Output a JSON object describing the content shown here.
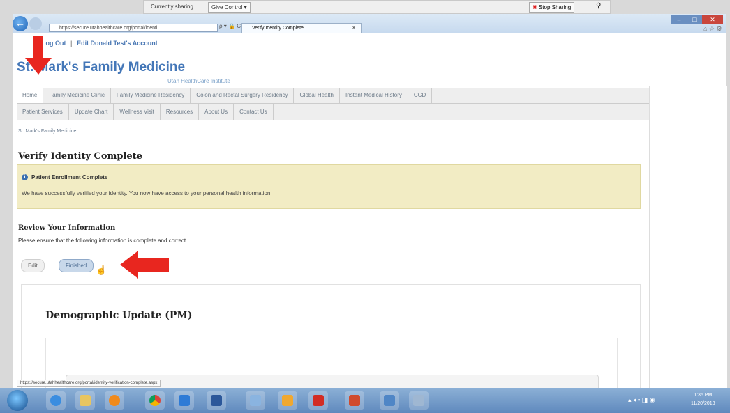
{
  "sharing_bar": {
    "currently_sharing": "Currently sharing",
    "give_control": "Give Control ▾",
    "stop_sharing": "Stop Sharing"
  },
  "browser": {
    "address": "https://secure.utahhealthcare.org/portal/identi",
    "tab_title": "Verify Identity Complete",
    "status_url": "https://secure.utahhealthcare.org/portal/identity-verification-complete.aspx"
  },
  "header": {
    "top_links_logout": "Log Out",
    "top_links_edit": "Edit Donald Test's Account",
    "site_title": "St. Mark's Family Medicine",
    "site_subtitle": "Utah HealthCare Institute"
  },
  "nav": {
    "row1": [
      "Home",
      "Family Medicine Clinic",
      "Family Medicine Residency",
      "Colon and Rectal Surgery Residency",
      "Global Health",
      "Instant Medical History",
      "CCD"
    ],
    "row2": [
      "Patient Services",
      "Update Chart",
      "Wellness Visit",
      "Resources",
      "About Us",
      "Contact Us"
    ]
  },
  "breadcrumb": "St. Mark's Family Medicine",
  "main": {
    "page_title": "Verify Identity Complete",
    "alert_title": "Patient Enrollment Complete",
    "alert_body": "We have successfully verified your identity. You now have access to your personal health information.",
    "review_title": "Review Your Information",
    "review_desc": "Please ensure that the following information is complete and correct.",
    "edit_label": "Edit",
    "finished_label": "Finished",
    "card_title": "Demographic Update (PM)"
  },
  "taskbar": {
    "clock_time": "1:35 PM",
    "clock_date": "11/20/2013"
  },
  "colors": {
    "accent": "#3a6fb0",
    "alert_bg": "#f2ecc4",
    "arrow": "#e8261f"
  }
}
